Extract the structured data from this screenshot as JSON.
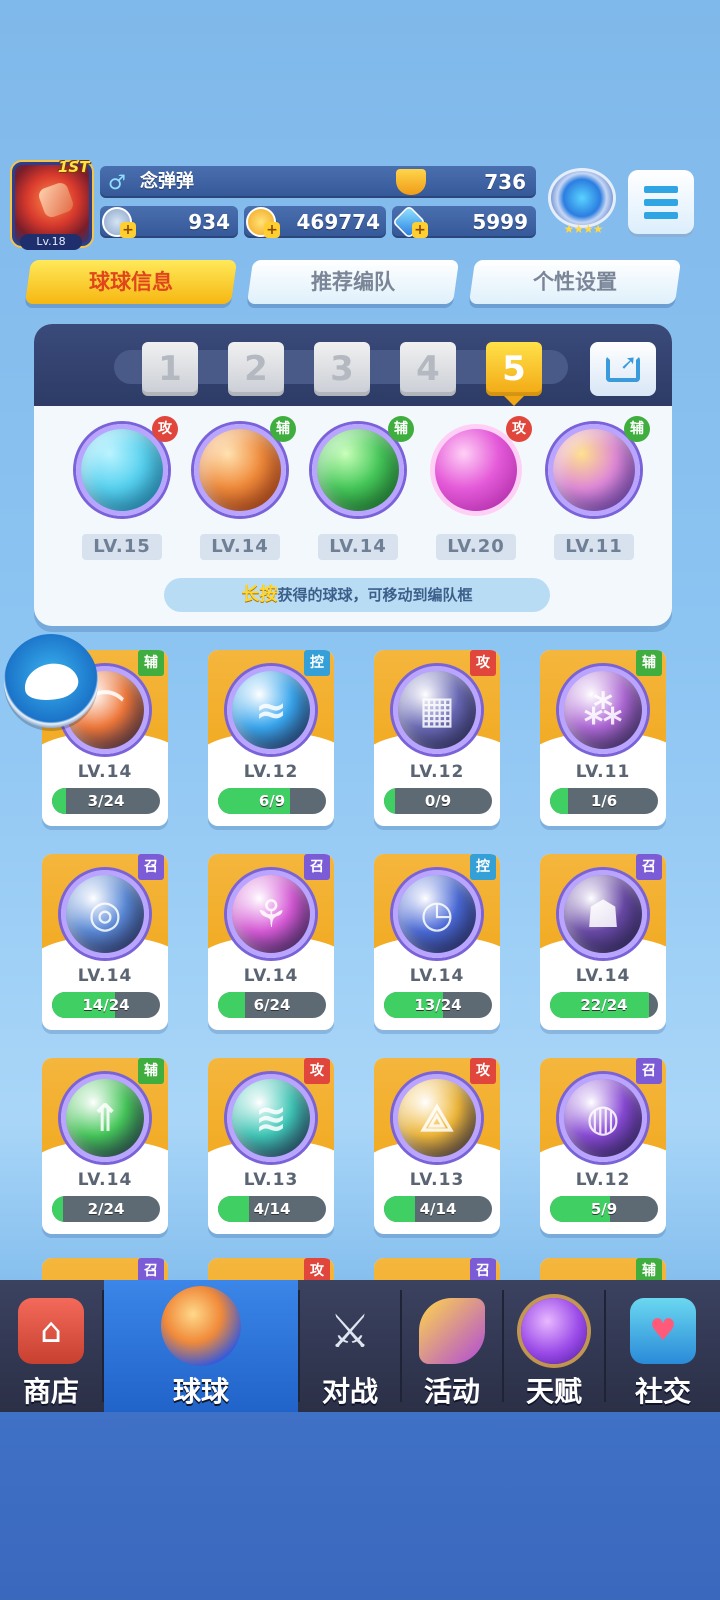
{
  "player": {
    "rank_badge": "1ST",
    "level": "Lv.18",
    "name": "念弹弹",
    "trophies": "736",
    "stamina": "934",
    "gold": "469774",
    "gems": "5999",
    "rank_stars": "★★★★"
  },
  "tabs": [
    {
      "label": "球球信息",
      "active": true
    },
    {
      "label": "推荐编队",
      "active": false
    },
    {
      "label": "个性设置",
      "active": false
    }
  ],
  "team_slots": [
    "1",
    "2",
    "3",
    "4",
    "5"
  ],
  "team_slot_active": "5",
  "team": [
    {
      "tag": "攻",
      "tag_type": "attack",
      "level": "LV.15",
      "icon": "anchor-ice-ball",
      "color": "#58d2f0"
    },
    {
      "tag": "辅",
      "tag_type": "support",
      "level": "LV.14",
      "icon": "phoenix-wing-ball",
      "color": "#f08a3a"
    },
    {
      "tag": "辅",
      "tag_type": "support",
      "level": "LV.14",
      "icon": "green-arrow-star-ball",
      "color": "#46c85a"
    },
    {
      "tag": "攻",
      "tag_type": "attack",
      "level": "LV.20",
      "icon": "pink-shield-ball",
      "color": "#e45ad8"
    },
    {
      "tag": "辅",
      "tag_type": "support",
      "level": "LV.11",
      "icon": "crowd-rainbow-ball",
      "color": "#b06ad8"
    }
  ],
  "hint": {
    "strong": "长按",
    "text": "获得的球球，可移动到编队框"
  },
  "cards": [
    {
      "tag": "辅",
      "tag_type": "support",
      "level": "LV.14",
      "progress": "3/24",
      "fill": 0.125,
      "icon": "phoenix-wing-ball",
      "color": "#f0783a"
    },
    {
      "tag": "控",
      "tag_type": "control",
      "level": "LV.12",
      "progress": "6/9",
      "fill": 0.667,
      "icon": "wave-ball",
      "color": "#3aa8f0"
    },
    {
      "tag": "攻",
      "tag_type": "attack",
      "level": "LV.12",
      "progress": "0/9",
      "fill": 0,
      "icon": "grid-dark-ball",
      "color": "#6a6ab8"
    },
    {
      "tag": "辅",
      "tag_type": "support",
      "level": "LV.11",
      "progress": "1/6",
      "fill": 0.167,
      "icon": "crowd-rainbow-ball",
      "color": "#b06ad8"
    },
    {
      "tag": "召",
      "tag_type": "summon",
      "level": "LV.14",
      "progress": "14/24",
      "fill": 0.583,
      "icon": "swirl-blue-ball",
      "color": "#5a8ad8"
    },
    {
      "tag": "召",
      "tag_type": "summon",
      "level": "LV.14",
      "progress": "6/24",
      "fill": 0.25,
      "icon": "mushroom-pink-ball",
      "color": "#d85ad8"
    },
    {
      "tag": "控",
      "tag_type": "control",
      "level": "LV.14",
      "progress": "13/24",
      "fill": 0.542,
      "icon": "clock-blue-ball",
      "color": "#4a6ad8"
    },
    {
      "tag": "召",
      "tag_type": "summon",
      "level": "LV.14",
      "progress": "22/24",
      "fill": 0.917,
      "icon": "ghost-purple-ball",
      "color": "#6a4aa8"
    },
    {
      "tag": "辅",
      "tag_type": "support",
      "level": "LV.14",
      "progress": "2/24",
      "fill": 0.083,
      "icon": "green-arrow-star-ball",
      "color": "#46c85a"
    },
    {
      "tag": "攻",
      "tag_type": "attack",
      "level": "LV.13",
      "progress": "4/14",
      "fill": 0.286,
      "icon": "tornado-teal-ball",
      "color": "#40c8b8"
    },
    {
      "tag": "攻",
      "tag_type": "attack",
      "level": "LV.13",
      "progress": "4/14",
      "fill": 0.286,
      "icon": "gold-triad-ball",
      "color": "#f0b83a"
    },
    {
      "tag": "召",
      "tag_type": "summon",
      "level": "LV.12",
      "progress": "5/9",
      "fill": 0.556,
      "icon": "planet-purple-ball",
      "color": "#8a4ad8"
    }
  ],
  "partial_row_tags": [
    {
      "tag": "召",
      "tag_type": "summon"
    },
    {
      "tag": "攻",
      "tag_type": "attack"
    },
    {
      "tag": "召",
      "tag_type": "summon"
    },
    {
      "tag": "辅",
      "tag_type": "support"
    }
  ],
  "nav": [
    {
      "label": "商店",
      "icon": "shop-icon",
      "active": false
    },
    {
      "label": "球球",
      "icon": "balls-icon",
      "active": true
    },
    {
      "label": "对战",
      "icon": "crossed-swords-icon",
      "active": false
    },
    {
      "label": "活动",
      "icon": "party-popper-icon",
      "active": false
    },
    {
      "label": "天赋",
      "icon": "planet-icon",
      "active": false
    },
    {
      "label": "社交",
      "icon": "chat-heart-icon",
      "active": false
    }
  ]
}
